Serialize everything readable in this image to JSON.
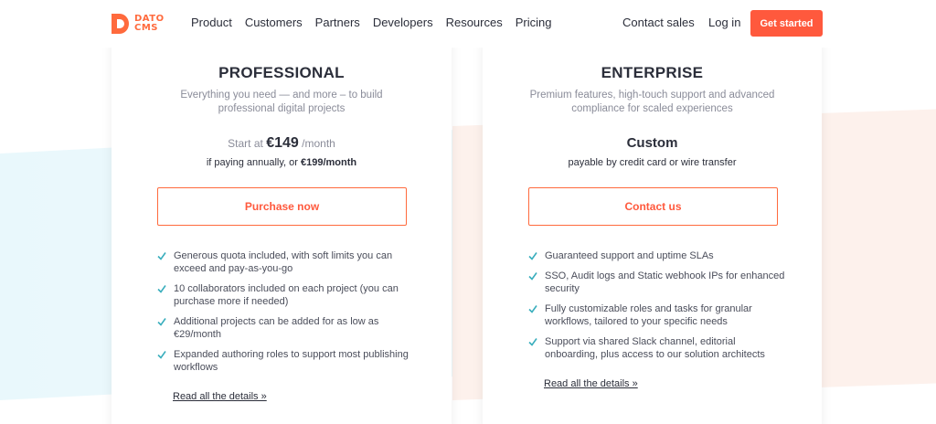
{
  "header": {
    "logo_text_1": "DATO",
    "logo_text_2": "CMS",
    "nav": [
      "Product",
      "Customers",
      "Partners",
      "Developers",
      "Resources",
      "Pricing"
    ],
    "contact_sales": "Contact sales",
    "login": "Log in",
    "get_started": "Get started"
  },
  "colors": {
    "accent": "#ff593d",
    "check": "#3aaebd"
  },
  "plans": {
    "professional": {
      "title": "PROFESSIONAL",
      "description": "Everything you need — and more – to build professional digital projects",
      "price_prefix": "Start at",
      "price": "€149",
      "price_suffix": "/month",
      "annual_prefix": "if paying annually, or",
      "annual_price": "€199/month",
      "cta": "Purchase now",
      "features": [
        "Generous quota included, with soft limits you can exceed and pay-as-you-go",
        "10 collaborators included on each project (you can purchase more if needed)",
        "Additional projects can be added for as low as €29/month",
        "Expanded authoring roles to support most publishing workflows"
      ],
      "details_link": "Read all the details »"
    },
    "enterprise": {
      "title": "ENTERPRISE",
      "description": "Premium features, high-touch support and advanced compliance for scaled experiences",
      "price_title": "Custom",
      "payment_note": "payable by credit card or wire transfer",
      "cta": "Contact us",
      "features": [
        "Guaranteed support and uptime SLAs",
        "SSO, Audit logs and Static webhook IPs for enhanced security",
        "Fully customizable roles and tasks for granular workflows, tailored to your specific needs",
        "Support via shared Slack channel, editorial onboarding, plus access to our solution architects"
      ],
      "details_link": "Read all the details »"
    }
  }
}
